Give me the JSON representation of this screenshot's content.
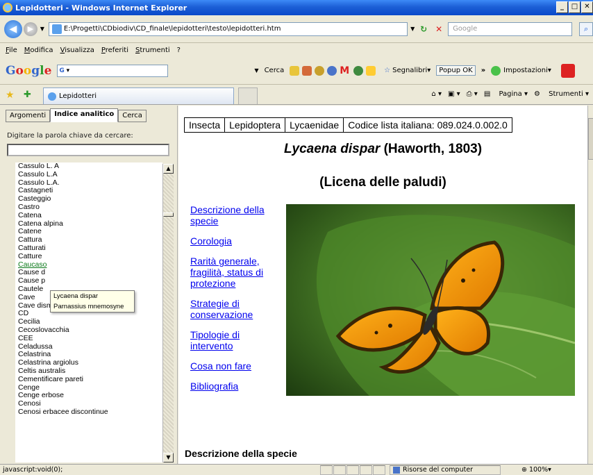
{
  "window": {
    "title": "Lepidotteri - Windows Internet Explorer"
  },
  "address": {
    "url": "E:\\Progetti\\CDbiodiv\\CD_finale\\lepidotteri\\testo\\lepidotteri.htm",
    "search_placeholder": "Google"
  },
  "menu": [
    "File",
    "Modifica",
    "Visualizza",
    "Preferiti",
    "Strumenti",
    "?"
  ],
  "googlebar": {
    "logo": "Google",
    "input_prefix": "G",
    "cerca": "Cerca",
    "segnalibri": "Segnalibri",
    "popup": "Popup OK",
    "impostazioni": "Impostazioni"
  },
  "tab": {
    "label": "Lepidotteri"
  },
  "commandbar": {
    "pagina": "Pagina",
    "strumenti": "Strumenti"
  },
  "leftpane": {
    "tabs": [
      "Argomenti",
      "Indice analitico",
      "Cerca"
    ],
    "prompt": "Digitare la parola chiave da cercare:",
    "list": [
      "Cassulo L. A",
      "Cassulo L.A",
      "Cassulo L.A.",
      "Castagneti",
      "Casteggio",
      "Castro",
      "Catena",
      "Catena alpina",
      "Catene",
      "Cattura",
      "Catturati",
      "Catture",
      "Caucaso",
      "Cause d",
      "Cause p",
      "Cautele",
      "Cave",
      "Cave dismesse",
      "CD",
      "Cecilia",
      "Cecoslovacchia",
      "CEE",
      "Celadussa",
      "Celastrina",
      "Celastrina argiolus",
      "Celtis australis",
      "Cementificare pareti",
      "Cenge",
      "Cenge erbose",
      "Cenosi",
      "Cenosi erbacee discontinue"
    ],
    "selected_index": 12,
    "popup": [
      "Lycaena dispar",
      "Parnassius mnemosyne"
    ]
  },
  "content": {
    "classification": [
      "Insecta",
      "Lepidoptera",
      "Lycaenidae",
      "Codice lista italiana: 089.024.0.002.0"
    ],
    "species_name": "Lycaena dispar",
    "species_author": "(Haworth, 1803)",
    "common_name": "(Licena delle paludi)",
    "links": [
      "Descrizione della specie",
      "Corologia",
      "Rarità generale, fragilità, status di protezione",
      "Strategie di conservazione",
      "Tipologie di intervento",
      "Cosa non fare",
      "Bibliografia"
    ],
    "section_heading": "Descrizione della specie"
  },
  "status": {
    "text": "javascript:void(0);",
    "zone": "Risorse del computer",
    "zoom": "100%"
  }
}
